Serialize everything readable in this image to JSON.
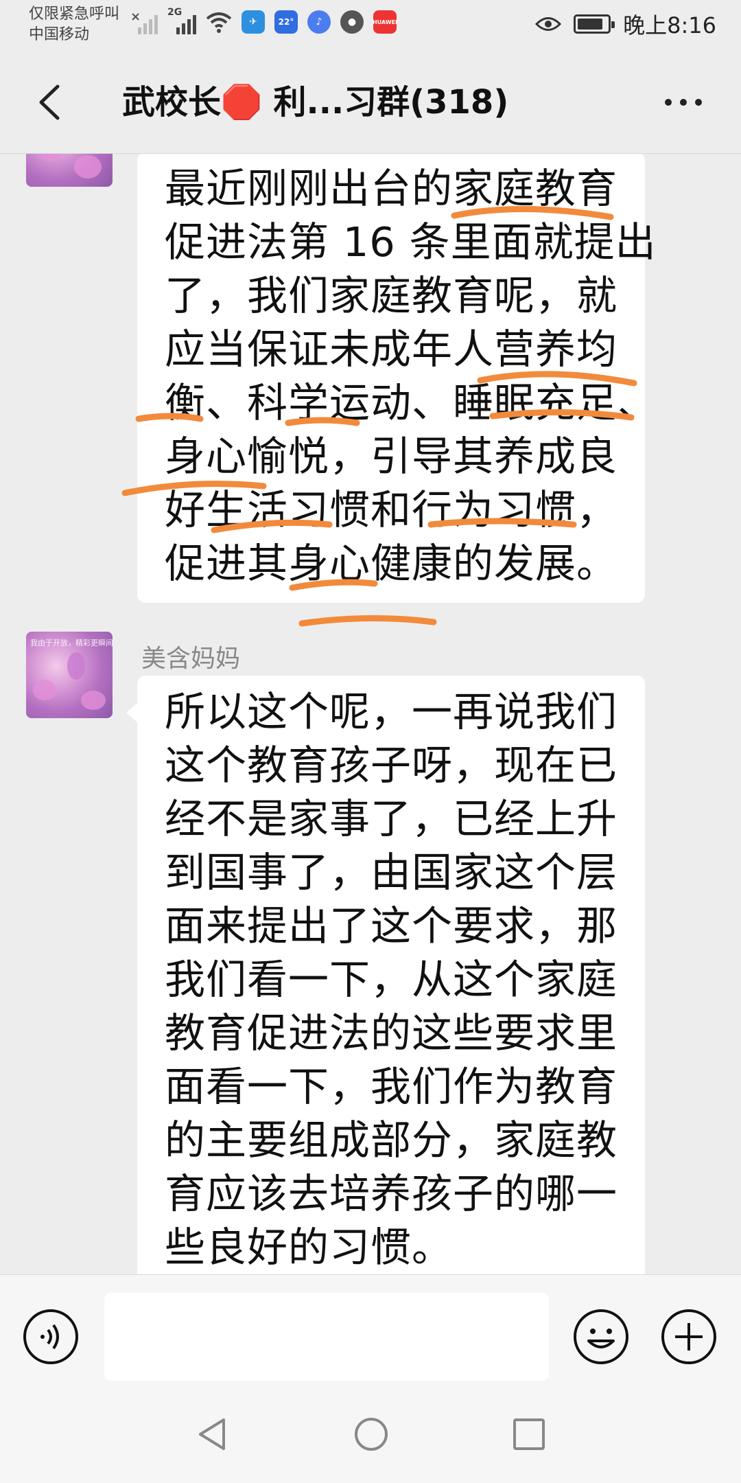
{
  "status_bar": {
    "carrier_line1": "仅限紧急呼叫",
    "carrier_line2": "中国移动",
    "network_label": "2G",
    "app_badges": [
      "✈",
      "22°",
      "♪",
      "●",
      "HUAWEI"
    ],
    "time": "晚上8:16",
    "battery_level": 0.85
  },
  "header": {
    "title": "武校长🛑 利...习群(318)",
    "back_icon": "chevron-left-icon",
    "more_icon": "more-dots-icon"
  },
  "messages": [
    {
      "sender": "",
      "lines": [
        "最近刚刚出台的家庭教育",
        "促进法第 16 条里面就提出",
        "了，我们家庭教育呢，就",
        "应当保证未成年人营养均",
        "衡、科学运动、睡眠充足、",
        "身心愉悦，引导其养成良",
        "好生活习惯和行为习惯，",
        "促进其身心健康的发展。"
      ]
    },
    {
      "sender": "美含妈妈",
      "avatar_caption": "我由于开放，精彩更瞬间",
      "lines": [
        "所以这个呢，一再说我们",
        "这个教育孩子呀，现在已",
        "经不是家事了，已经上升",
        "到国事了，由国家这个层",
        "面来提出了这个要求，那",
        "我们看一下，从这个家庭",
        "教育促进法的这些要求里",
        "面看一下，我们作为教育",
        "的主要组成部分，家庭教",
        "育应该去培养孩子的哪一",
        "些良好的习惯。"
      ]
    }
  ],
  "input_bar": {
    "voice_icon": "voice-input-icon",
    "input_value": "",
    "emoji_icon": "emoji-icon",
    "plus_icon": "plus-icon"
  },
  "nav_bar": {
    "back_icon": "nav-back-icon",
    "home_icon": "nav-home-icon",
    "recents_icon": "nav-recents-icon"
  },
  "colors": {
    "background": "#ededed",
    "bubble": "#ffffff",
    "annotation_stroke": "#f28a3c"
  }
}
